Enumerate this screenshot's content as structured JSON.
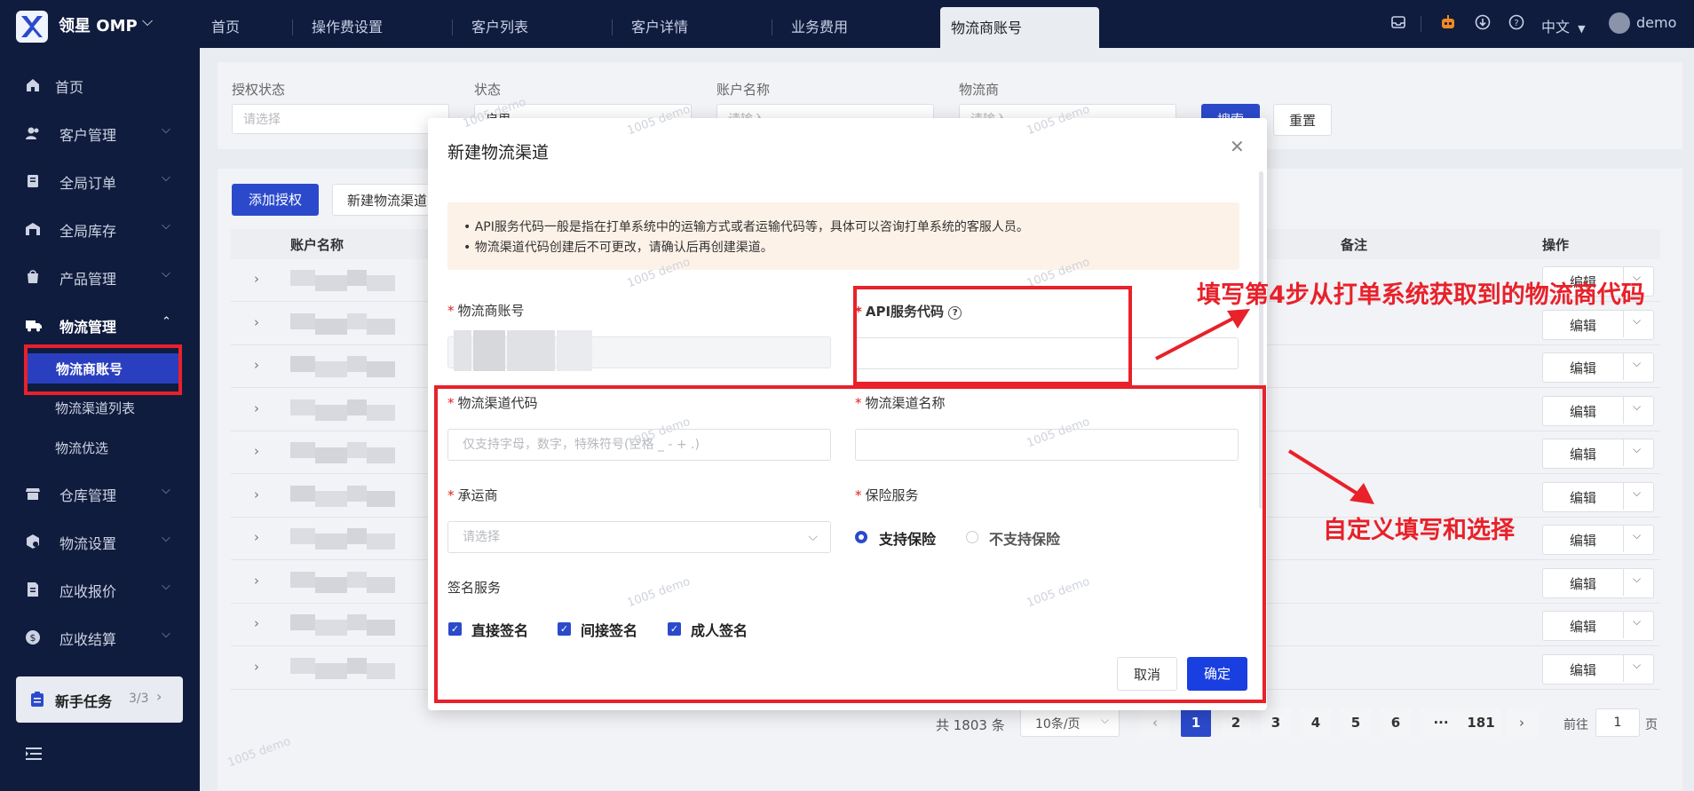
{
  "app": {
    "name": "领星 OMP",
    "brand_color": "#2b4acb",
    "topbar_color": "#101c3e"
  },
  "tabs": [
    "首页",
    "操作费设置",
    "客户列表",
    "客户详情",
    "业务费用",
    "物流商账号"
  ],
  "topbar": {
    "language": "中文",
    "user": "demo"
  },
  "sidebar": {
    "items": [
      {
        "label": "首页",
        "icon": "home-icon"
      },
      {
        "label": "客户管理",
        "icon": "users-icon"
      },
      {
        "label": "全局订单",
        "icon": "order-icon"
      },
      {
        "label": "全局库存",
        "icon": "warehouse-icon"
      },
      {
        "label": "产品管理",
        "icon": "product-icon"
      },
      {
        "label": "物流管理",
        "icon": "truck-icon"
      },
      {
        "label": "仓库管理",
        "icon": "store-icon"
      },
      {
        "label": "物流设置",
        "icon": "settings-box-icon"
      },
      {
        "label": "应收报价",
        "icon": "document-icon"
      },
      {
        "label": "应收结算",
        "icon": "dollar-icon"
      }
    ],
    "sub_items": [
      "物流商账号",
      "物流渠道列表",
      "物流优选"
    ],
    "new_task": {
      "label": "新手任务",
      "progress": "3/3"
    }
  },
  "filters": {
    "auth_status": {
      "label": "授权状态",
      "placeholder": "请选择"
    },
    "status": {
      "label": "状态",
      "value": "启用"
    },
    "account_name": {
      "label": "账户名称",
      "placeholder": "请输入"
    },
    "logistics_provider": {
      "label": "物流商",
      "placeholder": "请输入"
    },
    "search_label": "搜索",
    "reset_label": "重置"
  },
  "toolbar": {
    "add_auth": "添加授权",
    "new_channel": "新建物流渠道"
  },
  "table": {
    "headers": [
      "账户名称",
      "备注",
      "操作"
    ],
    "edit_label": "编辑",
    "row_count": 10
  },
  "pagination": {
    "total": "共 1803 条",
    "page_size": "10条/页",
    "pages": [
      "1",
      "2",
      "3",
      "4",
      "5",
      "6",
      "···",
      "181"
    ],
    "current": "1",
    "goto_prefix": "前往",
    "goto_value": "1",
    "goto_suffix": "页"
  },
  "modal": {
    "title": "新建物流渠道",
    "notice": [
      "API服务代码一般是指在打单系统中的运输方式或者运输代码等，具体可以咨询打单系统的客服人员。",
      "物流渠道代码创建后不可更改，请确认后再创建渠道。"
    ],
    "fields": {
      "account": {
        "label": "物流商账号"
      },
      "api_code": {
        "label": "API服务代码"
      },
      "channel_code": {
        "label": "物流渠道代码",
        "placeholder": "仅支持字母，数字，特殊符号(空格 _ - + .)"
      },
      "channel_name": {
        "label": "物流渠道名称"
      },
      "carrier": {
        "label": "承运商",
        "placeholder": "请选择"
      },
      "insurance": {
        "label": "保险服务",
        "options": [
          "支持保险",
          "不支持保险"
        ],
        "selected": "支持保险"
      },
      "signature": {
        "label": "签名服务",
        "options": [
          "直接签名",
          "间接签名",
          "成人签名"
        ]
      }
    },
    "cancel_label": "取消",
    "confirm_label": "确定"
  },
  "annotations": {
    "top": "填写第4步从打单系统获取到的物流商代码",
    "right": "自定义填写和选择",
    "color": "#e8212a"
  },
  "watermark": "1005 demo"
}
